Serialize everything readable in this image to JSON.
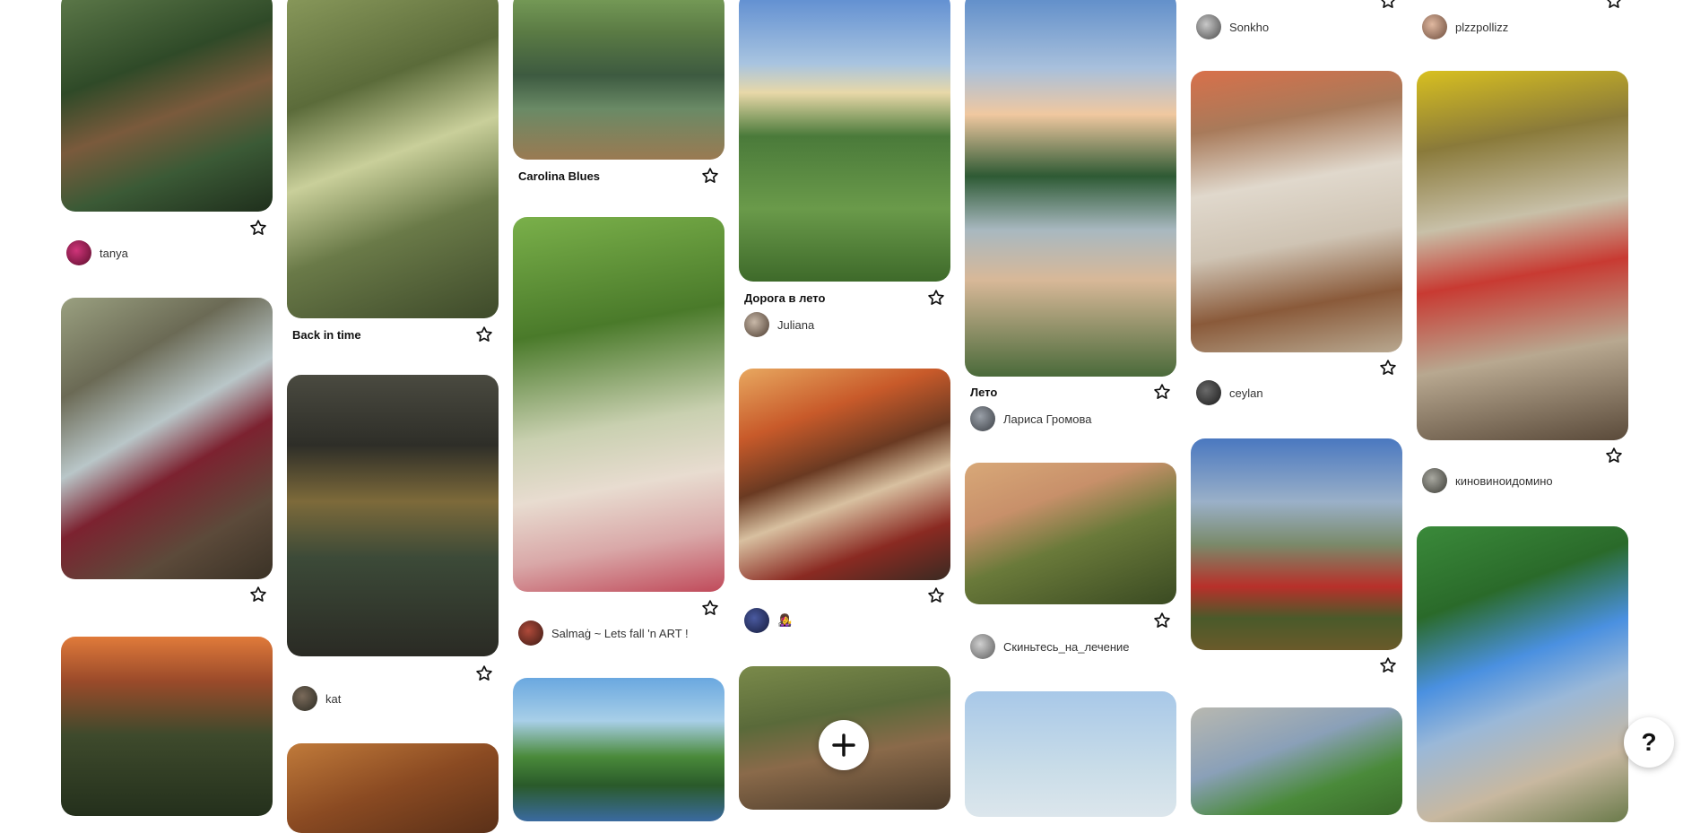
{
  "pins": {
    "p1": {
      "title": "",
      "author": ""
    },
    "p2": {
      "title": "",
      "author": "tanya"
    },
    "p3": {
      "title": "",
      "author": ""
    },
    "p5": {
      "title": "Back in time",
      "author": ""
    },
    "p6": {
      "title": "",
      "author": "kat"
    },
    "p8": {
      "title": "Carolina Blues",
      "author": ""
    },
    "p9": {
      "title": "",
      "author": "Salmaġ ~ Lets fall 'n ART !"
    },
    "p11": {
      "title": "Дорога в лето",
      "author": "Juliana"
    },
    "p12": {
      "title": "",
      "author": "👩‍🎤"
    },
    "p14": {
      "title": "Лето",
      "author": "Лариса Громова"
    },
    "p15": {
      "title": "",
      "author": "Скиньтесь_на_лечение"
    },
    "p17": {
      "author": "Sonkho"
    },
    "p18": {
      "title": "",
      "author": "ceylan"
    },
    "p21": {
      "author": "plzzpollizz"
    },
    "p22": {
      "title": "",
      "author": "киновиноидомино"
    }
  },
  "icons": {
    "star": "star-outline-icon",
    "add": "plus-icon",
    "help": "question-mark-icon"
  },
  "buttons": {
    "add_label": "+",
    "help_label": "?"
  },
  "colors": {
    "background": "#ffffff",
    "text": "#111111"
  }
}
